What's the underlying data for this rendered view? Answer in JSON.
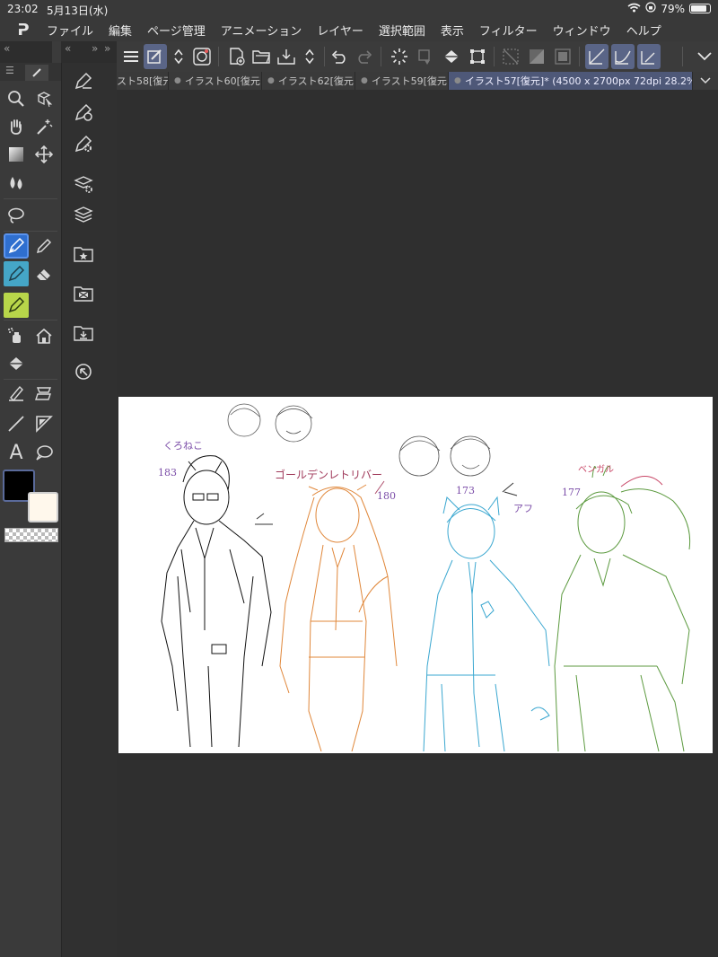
{
  "status": {
    "time": "23:02",
    "date": "5月13日(水)",
    "battery": "79%"
  },
  "menu": {
    "items": [
      "ファイル",
      "編集",
      "ページ管理",
      "アニメーション",
      "レイヤー",
      "選択範囲",
      "表示",
      "フィルター",
      "ウィンドウ",
      "ヘルプ"
    ]
  },
  "toolbar": {
    "left_pin": "«",
    "left_pin2": "«",
    "right_pin": "»",
    "right_pin2": "»"
  },
  "tabs": [
    {
      "label": "スト58[復元"
    },
    {
      "label": "イラスト60[復元"
    },
    {
      "label": "イラスト62[復元"
    },
    {
      "label": "イラスト59[復元"
    },
    {
      "label": "イラスト57[復元]* (4500 x 2700px 72dpi 28.2%)"
    }
  ],
  "colors": {
    "accent": "#2f6fcf",
    "main_color": "#000000",
    "sub_color": "#fff8ec"
  },
  "canvas_notes": {
    "n1": "くろねこ",
    "n2": "183",
    "n3": "ゴールデンレトリバー",
    "n4": "180",
    "n5": "173",
    "n6": "177",
    "n7": "ベンガル",
    "n8": "アフ"
  },
  "icons": {
    "text_tool": "A"
  }
}
